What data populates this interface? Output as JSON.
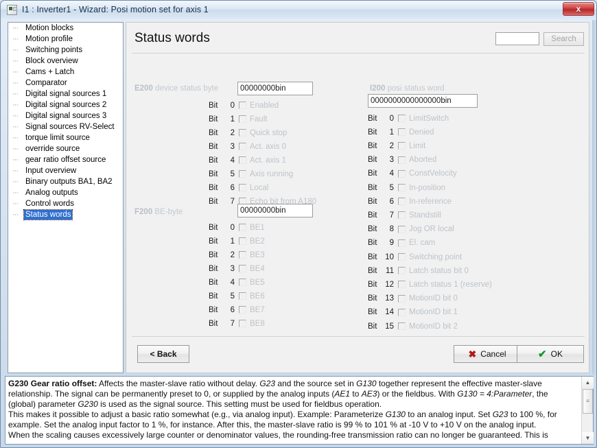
{
  "window": {
    "title": "I1 : Inverter1 - Wizard: Posi motion set for axis 1",
    "close_label": "x",
    "sysicon": "application-icon"
  },
  "sidebar": {
    "items": [
      {
        "label": "Motion blocks",
        "selected": false
      },
      {
        "label": "Motion profile",
        "selected": false
      },
      {
        "label": "Switching points",
        "selected": false
      },
      {
        "label": "Block overview",
        "selected": false
      },
      {
        "label": "Cams + Latch",
        "selected": false
      },
      {
        "label": "Comparator",
        "selected": false
      },
      {
        "label": "Digital signal sources 1",
        "selected": false
      },
      {
        "label": "Digital signal sources 2",
        "selected": false
      },
      {
        "label": "Digital signal sources 3",
        "selected": false
      },
      {
        "label": "Signal sources RV-Select",
        "selected": false
      },
      {
        "label": "torque limit source",
        "selected": false
      },
      {
        "label": "override source",
        "selected": false
      },
      {
        "label": "gear ratio offset source",
        "selected": false
      },
      {
        "label": "Input overview",
        "selected": false
      },
      {
        "label": "Binary outputs BA1, BA2",
        "selected": false
      },
      {
        "label": "Analog outputs",
        "selected": false
      },
      {
        "label": "Control words",
        "selected": false
      },
      {
        "label": "Status words",
        "selected": true
      }
    ]
  },
  "main": {
    "page_title": "Status words",
    "search": {
      "value": "",
      "placeholder": "",
      "button_label": "Search"
    },
    "groups": {
      "e200": {
        "code": "E200",
        "desc": "device status byte",
        "value": "00000000bin",
        "bit_word": "Bit",
        "bits": [
          {
            "num": "0",
            "label": "Enabled",
            "checked": false
          },
          {
            "num": "1",
            "label": "Fault",
            "checked": false
          },
          {
            "num": "2",
            "label": "Quick stop",
            "checked": false
          },
          {
            "num": "3",
            "label": "Act. axis 0",
            "checked": false
          },
          {
            "num": "4",
            "label": "Act. axis 1",
            "checked": false
          },
          {
            "num": "5",
            "label": "Axis running",
            "checked": false
          },
          {
            "num": "6",
            "label": "Local",
            "checked": false
          },
          {
            "num": "7",
            "label": "Echo bit from A180",
            "checked": false
          }
        ]
      },
      "f200": {
        "code": "F200",
        "desc": "BE-byte",
        "value": "00000000bin",
        "bit_word": "Bit",
        "bits": [
          {
            "num": "0",
            "label": "BE1",
            "checked": false
          },
          {
            "num": "1",
            "label": "BE2",
            "checked": false
          },
          {
            "num": "2",
            "label": "BE3",
            "checked": false
          },
          {
            "num": "3",
            "label": "BE4",
            "checked": false
          },
          {
            "num": "4",
            "label": "BE5",
            "checked": false
          },
          {
            "num": "5",
            "label": "BE6",
            "checked": false
          },
          {
            "num": "6",
            "label": "BE7",
            "checked": false
          },
          {
            "num": "7",
            "label": "BE8",
            "checked": false
          }
        ]
      },
      "i200": {
        "code": "I200",
        "desc": "posi status word",
        "value": "0000000000000000bin",
        "bit_word": "Bit",
        "bits": [
          {
            "num": "0",
            "label": "LimitSwitch",
            "checked": false
          },
          {
            "num": "1",
            "label": "Denied",
            "checked": false
          },
          {
            "num": "2",
            "label": "Limit",
            "checked": false
          },
          {
            "num": "3",
            "label": "Aborted",
            "checked": false
          },
          {
            "num": "4",
            "label": "ConstVelocity",
            "checked": false
          },
          {
            "num": "5",
            "label": "In-position",
            "checked": false
          },
          {
            "num": "6",
            "label": "In-reference",
            "checked": false
          },
          {
            "num": "7",
            "label": "Standstill",
            "checked": false
          },
          {
            "num": "8",
            "label": "Jog OR local",
            "checked": false
          },
          {
            "num": "9",
            "label": "El. cam",
            "checked": false
          },
          {
            "num": "10",
            "label": "Switching point",
            "checked": false
          },
          {
            "num": "11",
            "label": "Latch status bit 0",
            "checked": false
          },
          {
            "num": "12",
            "label": "Latch status 1 (reserve)",
            "checked": false
          },
          {
            "num": "13",
            "label": "MotionID bit 0",
            "checked": false
          },
          {
            "num": "14",
            "label": "MotionID bit 1",
            "checked": false
          },
          {
            "num": "15",
            "label": "MotionID bit 2",
            "checked": false
          }
        ]
      }
    },
    "footer": {
      "back_label": "< Back",
      "cancel_label": "Cancel",
      "ok_label": "OK",
      "cancel_icon": "x-mark-icon",
      "ok_icon": "check-mark-icon"
    }
  },
  "help": {
    "lines": [
      [
        {
          "t": "G230  Gear ratio offset:",
          "s": "b"
        },
        {
          "t": " Affects the master-slave ratio without delay. ",
          "s": "n"
        },
        {
          "t": "G23",
          "s": "i"
        },
        {
          "t": " and the source set in ",
          "s": "n"
        },
        {
          "t": "G130",
          "s": "i"
        },
        {
          "t": " together represent the effective master-slave",
          "s": "n"
        }
      ],
      [
        {
          "t": "relationship. The signal can be permanently preset to 0, or supplied by the analog inputs (",
          "s": "n"
        },
        {
          "t": "AE1",
          "s": "i"
        },
        {
          "t": " to ",
          "s": "n"
        },
        {
          "t": "AE3",
          "s": "i"
        },
        {
          "t": ") or the fieldbus. With ",
          "s": "n"
        },
        {
          "t": "G130 = 4:Parameter",
          "s": "i"
        },
        {
          "t": ", the",
          "s": "n"
        }
      ],
      [
        {
          "t": "(global) parameter ",
          "s": "n"
        },
        {
          "t": "G230",
          "s": "i"
        },
        {
          "t": " is used as the signal source. This setting must be used for fieldbus operation.",
          "s": "n"
        }
      ],
      [
        {
          "t": "This makes it possible to adjust a basic ratio somewhat (e.g., via analog input). Example: Parameterize ",
          "s": "n"
        },
        {
          "t": "G130",
          "s": "i"
        },
        {
          "t": " to an analog input. Set ",
          "s": "n"
        },
        {
          "t": "G23",
          "s": "i"
        },
        {
          "t": " to 100 %, for",
          "s": "n"
        }
      ],
      [
        {
          "t": "example. Set the analog input factor to 1 %, for instance. After this, the master-slave ratio is 99 % to 101 % at -10 V to +10 V on the analog input.",
          "s": "n"
        }
      ],
      [
        {
          "t": "When the scaling causes excessively large counter or denominator values, the rounding-free transmission ratio can no longer be guaranteed. This is",
          "s": "n"
        }
      ]
    ],
    "scrollbar": {
      "up": "▲",
      "down": "▼",
      "thumb": "≡"
    }
  }
}
